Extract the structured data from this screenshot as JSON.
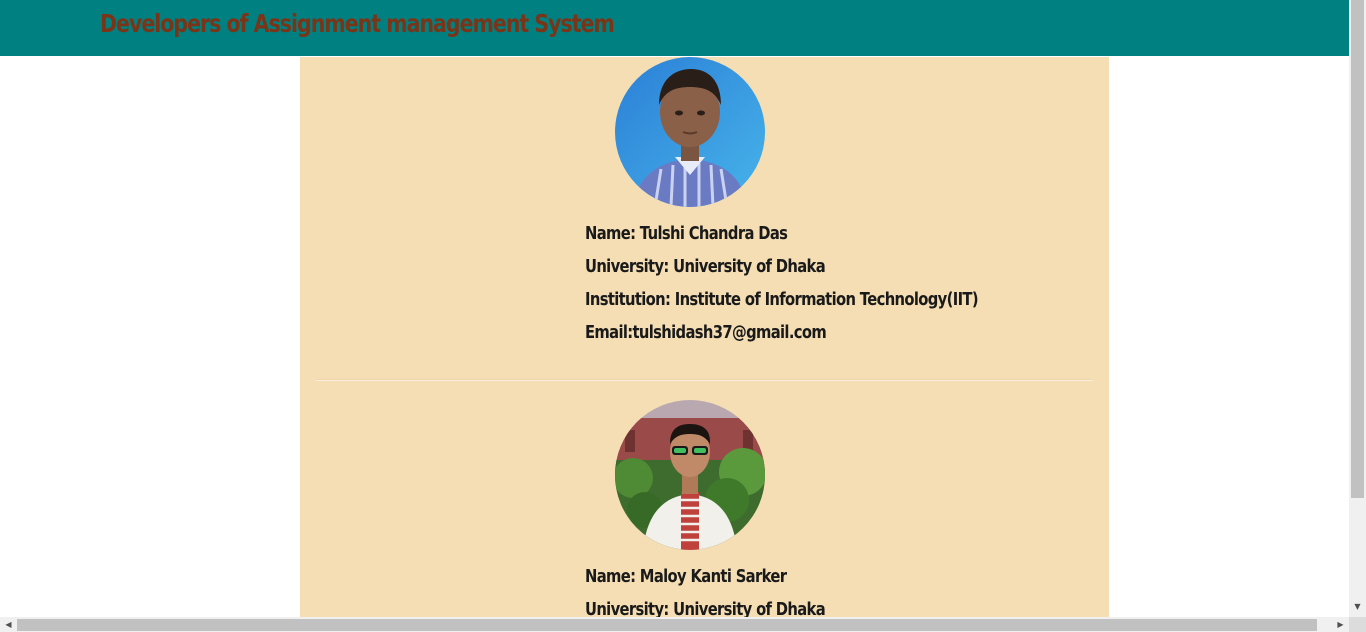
{
  "header": {
    "title": "Developers of Assignment management System"
  },
  "colors": {
    "header_bg": "#008080",
    "title_color": "#7a3518",
    "content_bg": "#f5deb3"
  },
  "developers": [
    {
      "photo": "developer-photo",
      "name_line": "Name: Tulshi Chandra Das",
      "university_line": "University: University of Dhaka",
      "institution_line": "Institution: Institute of Information Technology(IIT)",
      "email_line": "Email:tulshidash37@gmail.com"
    },
    {
      "photo": "developer-photo",
      "name_line": "Name: Maloy Kanti Sarker",
      "university_line": "University: University of Dhaka"
    }
  ],
  "scrollbars": {
    "up_arrow": "▲",
    "down_arrow": "▼",
    "left_arrow": "◀",
    "right_arrow": "▶"
  }
}
